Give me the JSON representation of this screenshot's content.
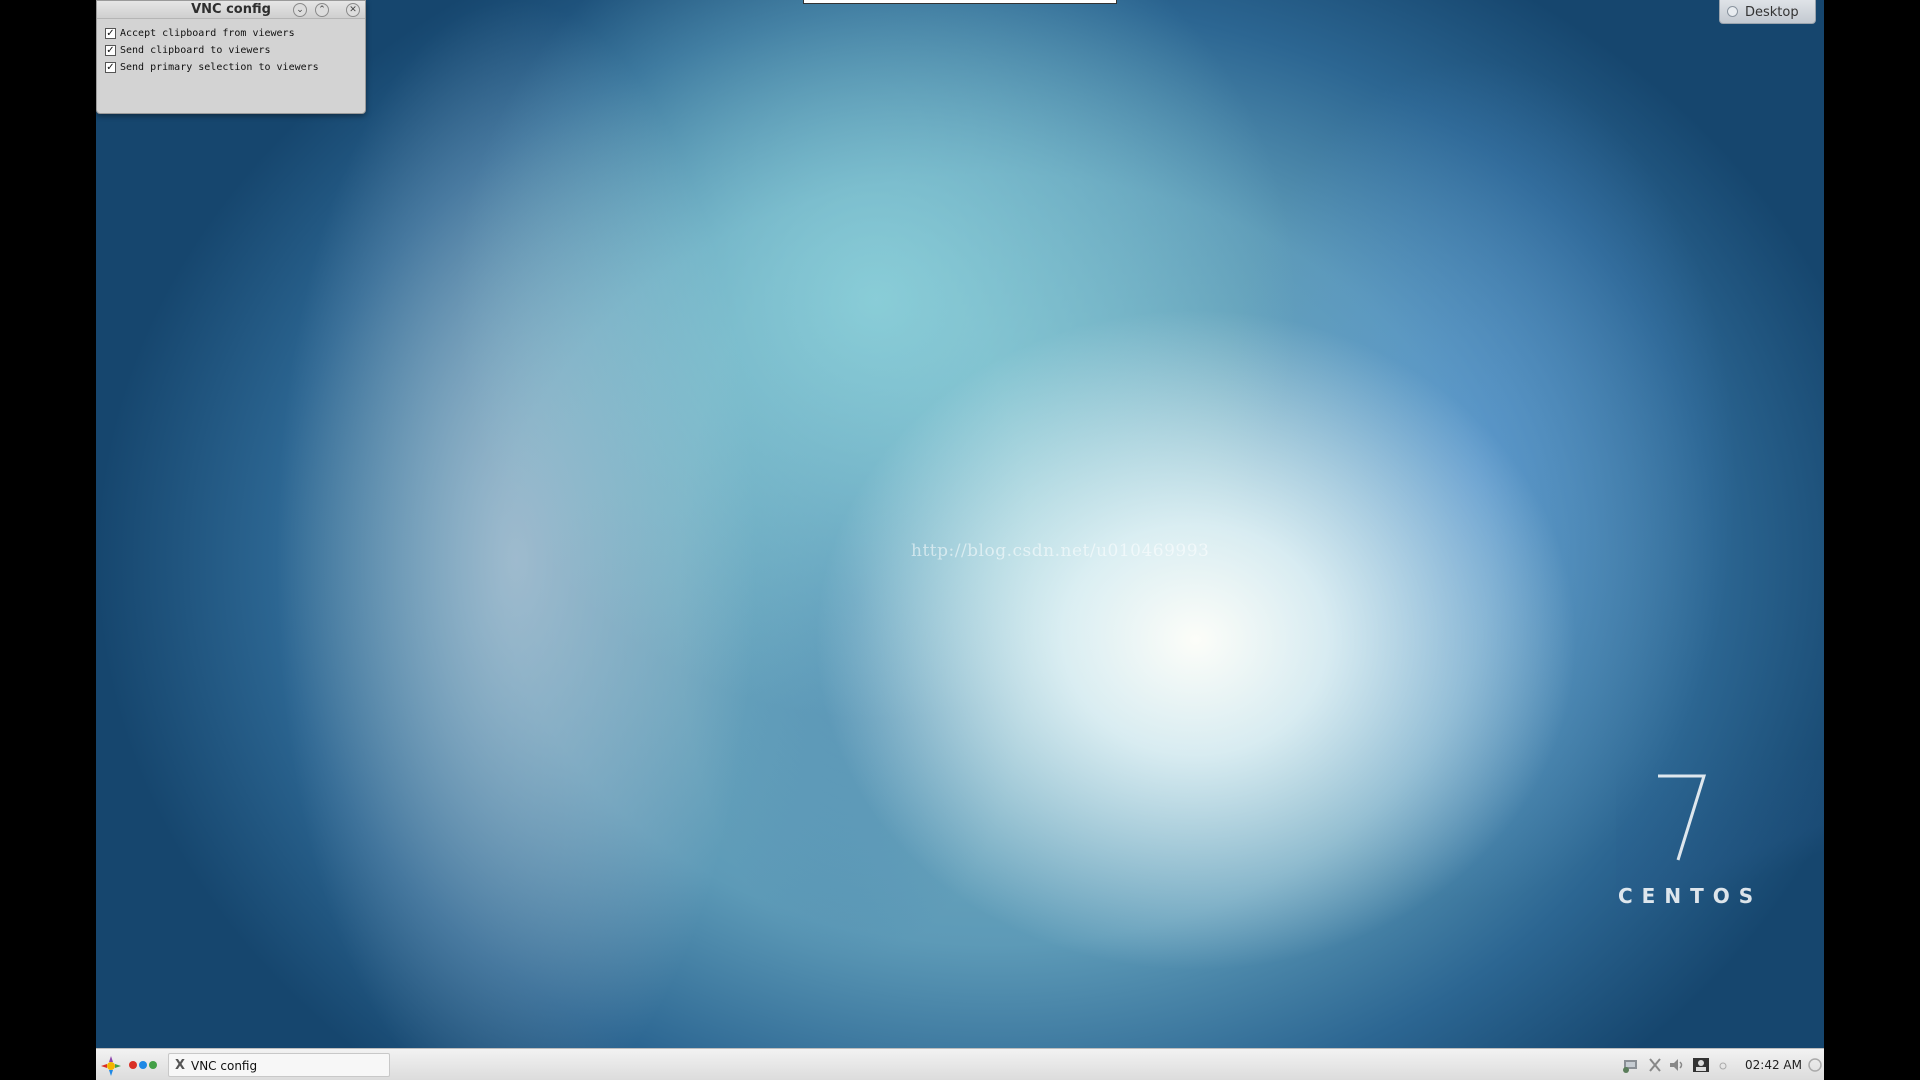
{
  "vnc_window": {
    "title": "VNC config",
    "options": [
      {
        "label": "Accept clipboard from viewers",
        "checked": true
      },
      {
        "label": "Send clipboard to viewers",
        "checked": true
      },
      {
        "label": "Send primary selection to viewers",
        "checked": true
      }
    ],
    "check_mark": "✓"
  },
  "desktop_button": {
    "label": "Desktop"
  },
  "watermark": "http://blog.csdn.net/u010469993",
  "branding": {
    "number": "7",
    "name": "CENTOS"
  },
  "taskbar": {
    "task_label": "VNC config",
    "clock": "02:42 AM",
    "dot_colors": [
      "#d93025",
      "#1e88e5",
      "#43a047"
    ]
  }
}
